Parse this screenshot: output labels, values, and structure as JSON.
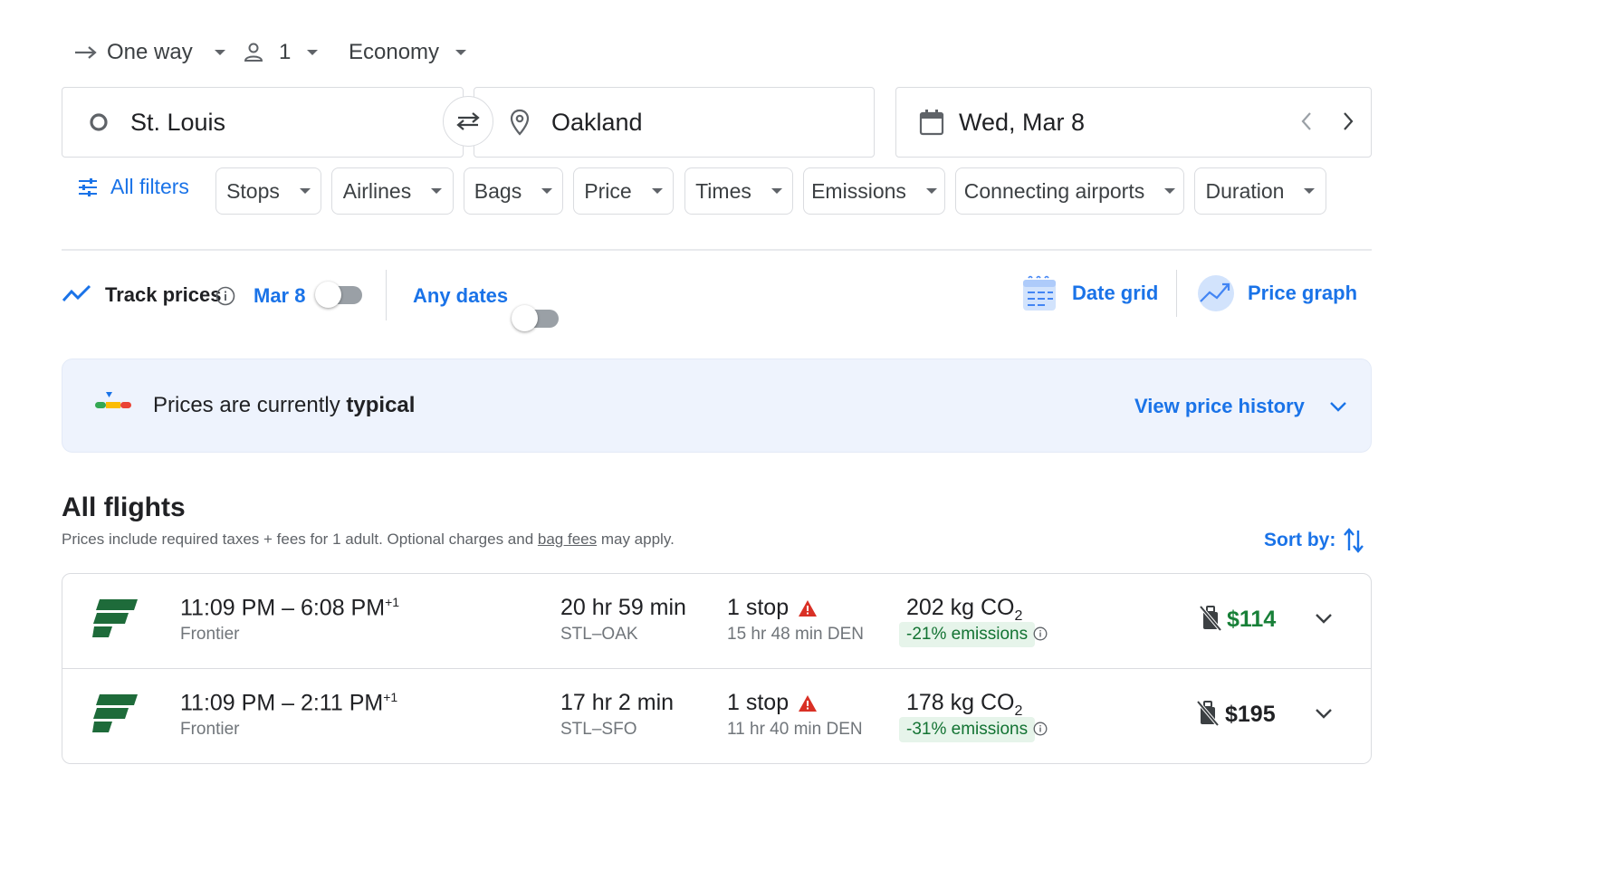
{
  "trip": {
    "type": "One way",
    "passengers": "1",
    "class": "Economy"
  },
  "search": {
    "origin": "St. Louis",
    "destination": "Oakland",
    "date": "Wed, Mar 8"
  },
  "filters": {
    "all_filters": "All filters",
    "chips": [
      "Stops",
      "Airlines",
      "Bags",
      "Price",
      "Times",
      "Emissions",
      "Connecting airports",
      "Duration"
    ]
  },
  "track": {
    "label": "Track prices",
    "date": "Mar 8",
    "any_dates": "Any dates",
    "track_on": false,
    "any_dates_on": false,
    "date_grid": "Date grid",
    "price_graph": "Price graph"
  },
  "banner": {
    "prefix": "Prices are currently ",
    "status": "typical",
    "history_link": "View price history"
  },
  "results": {
    "title": "All flights",
    "note_before": "Prices include required taxes + fees for 1 adult. Optional charges and ",
    "note_link": "bag fees",
    "note_after": " may apply.",
    "sort_label": "Sort by:",
    "flights": [
      {
        "times": "11:09 PM – 6:08 PM",
        "plus_day": "+1",
        "airline": "Frontier",
        "duration": "20 hr 59 min",
        "route": "STL–OAK",
        "stops": "1 stop",
        "layover": "15 hr 48 min DEN",
        "co2": "202 kg CO",
        "co2_sub": "2",
        "emissions": "-21% emissions",
        "price": "$114",
        "price_color": "#188038"
      },
      {
        "times": "11:09 PM – 2:11 PM",
        "plus_day": "+1",
        "airline": "Frontier",
        "duration": "17 hr 2 min",
        "route": "STL–SFO",
        "stops": "1 stop",
        "layover": "11 hr 40 min DEN",
        "co2": "178 kg CO",
        "co2_sub": "2",
        "emissions": "-31% emissions",
        "price": "$195",
        "price_color": "#202124"
      }
    ]
  },
  "colors": {
    "accent": "#1a73e8",
    "frontier_green": "#1e6b3a",
    "warning_red": "#d93025"
  }
}
